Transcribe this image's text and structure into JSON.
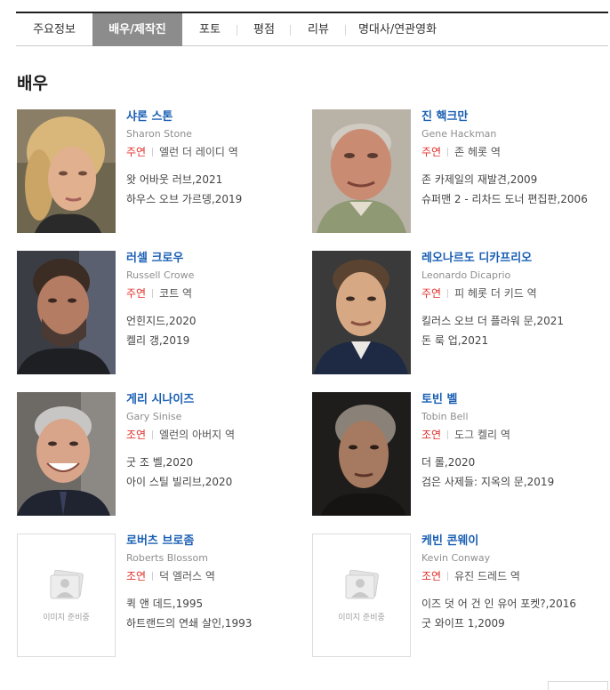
{
  "tabs": [
    {
      "label": "주요정보",
      "active": false
    },
    {
      "label": "배우/제작진",
      "active": true
    },
    {
      "label": "포토",
      "active": false
    },
    {
      "label": "평점",
      "active": false
    },
    {
      "label": "리뷰",
      "active": false
    },
    {
      "label": "명대사/연관영화",
      "active": false
    }
  ],
  "section_title": "배우",
  "no_image_label": "이미지 준비중",
  "actors": [
    {
      "name_ko": "샤론 스톤",
      "name_en": "Sharon Stone",
      "role_type": "주연",
      "role": "엘런 더 레이디 역",
      "films": [
        "왓 어바웃 러브,2021",
        "하우스 오브 가르뎅,2019"
      ],
      "photo": "sharon-stone-photo"
    },
    {
      "name_ko": "진 핵크만",
      "name_en": "Gene Hackman",
      "role_type": "주연",
      "role": "존 헤롯 역",
      "films": [
        "존 카제일의 재발견,2009",
        "슈퍼맨 2 - 리차드 도너 편집판,2006"
      ],
      "photo": "gene-hackman-photo"
    },
    {
      "name_ko": "러셀 크로우",
      "name_en": "Russell Crowe",
      "role_type": "주연",
      "role": "코트 역",
      "films": [
        "언힌지드,2020",
        "켈리 갱,2019"
      ],
      "photo": "russell-crowe-photo"
    },
    {
      "name_ko": "레오나르도 디카프리오",
      "name_en": "Leonardo Dicaprio",
      "role_type": "주연",
      "role": "피 헤롯 더 키드 역",
      "films": [
        "킬러스 오브 더 플라워 문,2021",
        "돈 룩 업,2021"
      ],
      "photo": "leonardo-dicaprio-photo"
    },
    {
      "name_ko": "게리 시나이즈",
      "name_en": "Gary Sinise",
      "role_type": "조연",
      "role": "엘런의 아버지 역",
      "films": [
        "굿 조 벨,2020",
        "아이 스틸 빌리브,2020"
      ],
      "photo": "gary-sinise-photo"
    },
    {
      "name_ko": "토빈 벨",
      "name_en": "Tobin Bell",
      "role_type": "조연",
      "role": "도그 켈리 역",
      "films": [
        "더 롤,2020",
        "검은 사제들: 지옥의 문,2019"
      ],
      "photo": "tobin-bell-photo"
    },
    {
      "name_ko": "로버츠 브로좀",
      "name_en": "Roberts Blossom",
      "role_type": "조연",
      "role": "덕 엘러스 역",
      "films": [
        "퀵 앤 데드,1995",
        "하트랜드의 연쇄 살인,1993"
      ],
      "photo": "none"
    },
    {
      "name_ko": "케빈 콘웨이",
      "name_en": "Kevin Conway",
      "role_type": "조연",
      "role": "유진 드레드 역",
      "films": [
        "이즈 덧 어 건 인 유어 포켓?,2016",
        "굿 와이프 1,2009"
      ],
      "photo": "none"
    }
  ],
  "colors": {
    "accent_red": "#e0312c",
    "link_blue": "#1a5fb4",
    "active_tab": "#8c8c8c"
  }
}
